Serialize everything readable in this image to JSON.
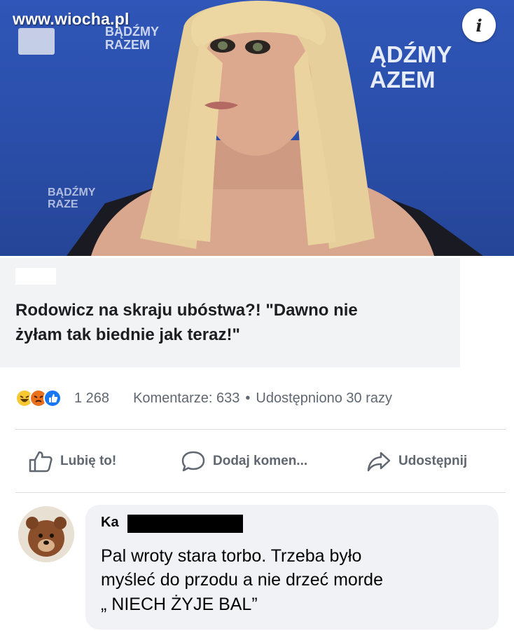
{
  "watermark": "www.wiocha.pl",
  "photo": {
    "banner_right": [
      "ĄDŹMY",
      "AZEM"
    ],
    "banner_top": [
      "BĄDŹMY",
      "RAZEM"
    ],
    "banner_left": [
      "BĄDŹMY",
      "RAZE"
    ],
    "info_icon": "info-icon"
  },
  "headline": {
    "line1": "Rodowicz na skraju ubóstwa?! \"Dawno nie",
    "line2": "żyłam tak biednie jak teraz!\""
  },
  "reactions": {
    "icons": [
      "haha-reaction-icon",
      "angry-reaction-icon",
      "like-reaction-icon"
    ],
    "count": "1 268",
    "comments": "Komentarze: 633",
    "separator": "•",
    "shares": "Udostępniono 30 razy"
  },
  "actions": {
    "like": "Lubię to!",
    "comment": "Dodaj komen...",
    "share": "Udostępnij"
  },
  "comment": {
    "author_visible": "Ka",
    "lines": [
      "Pal wroty stara torbo. Trzeba było",
      "myśleć do przodu a nie drzeć morde",
      "„ NIECH ŻYJE BAL”"
    ]
  },
  "colors": {
    "photo_background": "#2f56b8",
    "card_background": "#f2f3f5",
    "like_blue": "#1877f2",
    "secondary_text": "#606770"
  }
}
